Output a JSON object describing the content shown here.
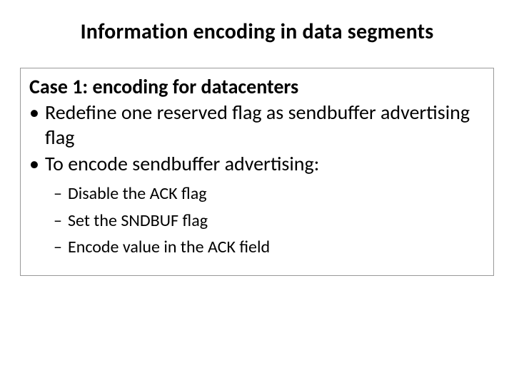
{
  "title": "Information encoding in data segments",
  "subhead": "Case 1: encoding for datacenters",
  "bullets": [
    "Redefine one reserved flag as sendbuffer advertising flag",
    "To encode sendbuffer advertising:"
  ],
  "subbullets": [
    "Disable the ACK flag",
    "Set the SNDBUF flag",
    "Encode value in the ACK field"
  ],
  "glyphs": {
    "dot": "•",
    "dash": "–"
  }
}
